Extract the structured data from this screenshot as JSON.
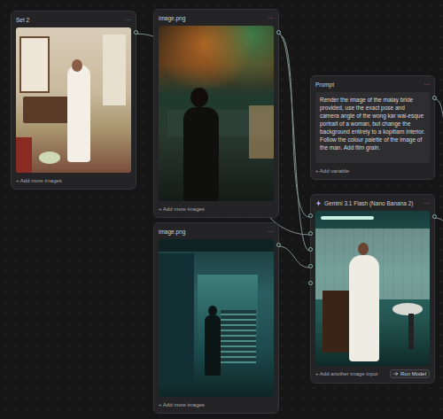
{
  "canvas": {
    "nodes": [
      {
        "kind": "image",
        "title": "Set 2",
        "menu": "···",
        "footer": "+ Add more images"
      },
      {
        "kind": "image",
        "title": "image.png",
        "menu": "···",
        "footer": "+ Add more images"
      },
      {
        "kind": "image",
        "title": "image.png",
        "menu": "···",
        "footer": "+ Add more images"
      },
      {
        "kind": "prompt",
        "title": "Prompt",
        "menu": "···",
        "text": "Render the image of the malay bride provided, use the exact pose and camera angle of the wong kar wai-esque portrait of a woman, but change the background entirely to a kopitiam interior. Follow the colour palette of the image of the man. Add film grain.",
        "footer": "+ Add variable"
      },
      {
        "kind": "model",
        "title": "Gemini 3.1 Flash (Nano Banana 2)",
        "menu": "···",
        "footer": "+ Add another image input",
        "button": "Run Model"
      }
    ]
  }
}
